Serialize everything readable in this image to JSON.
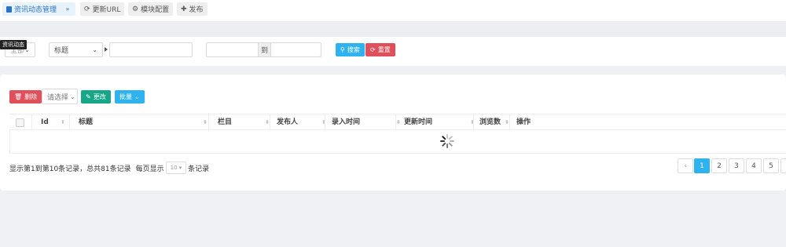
{
  "toolbar": {
    "module_title": "资讯动态管理",
    "collapse_icon": "double-chevron-down",
    "refresh_label": "更新URL",
    "config_label": "模块配置",
    "publish_label": "发布"
  },
  "search": {
    "tooltip": "资讯动态",
    "category_value": "全部",
    "field_select_value": "标题",
    "keyword_value": "",
    "date_from_value": "",
    "date_separator": "到",
    "date_to_value": "",
    "search_label": "搜索",
    "reset_label": "重置"
  },
  "actions": {
    "delete_label": "删除",
    "choose_placeholder": "请选择",
    "edit_label": "更改",
    "batch_label": "批量"
  },
  "table": {
    "columns": [
      "Id",
      "标题",
      "栏目",
      "发布人",
      "录入时间",
      "更新时间",
      "浏览数",
      "操作"
    ]
  },
  "pagination": {
    "summary": "显示第1到第10条记录，总共81条记录",
    "per_page_prefix": "每页显示",
    "per_page_value": "10",
    "per_page_suffix": "条记录",
    "prev": "‹",
    "pages": [
      "1",
      "2",
      "3",
      "4",
      "5"
    ],
    "current_page": "1"
  },
  "colors": {
    "primary_blue": "#2fb2f0",
    "danger_red": "#e0505b",
    "teal": "#18a689"
  }
}
